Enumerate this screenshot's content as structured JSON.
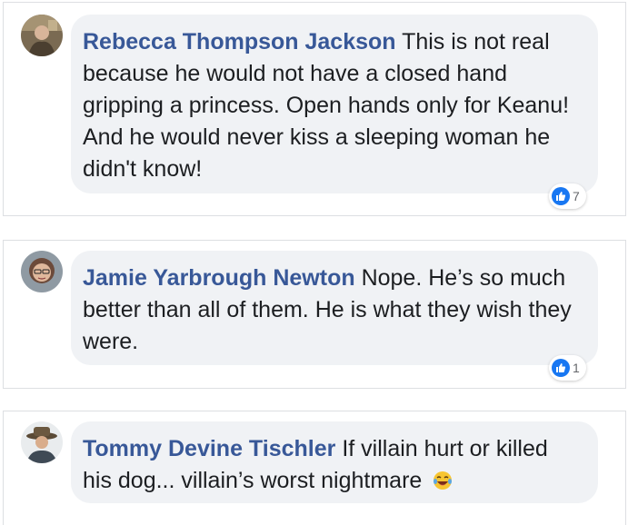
{
  "comments": [
    {
      "author": "Rebecca Thompson Jackson",
      "text": "This is not real because he would not have a closed hand gripping a princess. Open hands only for Keanu! And he would never kiss a sleeping woman he didn't know!",
      "reaction_icon": "like-icon",
      "reaction_count": "7"
    },
    {
      "author": "Jamie Yarbrough Newton",
      "text": "Nope. He’s so much better than all of them. He is what they wish they were.",
      "reaction_icon": "like-icon",
      "reaction_count": "1"
    },
    {
      "author": "Tommy Devine Tischler",
      "text": "If villain hurt or killed his dog... villain’s worst nightmare",
      "emoji": "laughing-tears-emoji"
    }
  ],
  "colors": {
    "author_link": "#385898",
    "bubble_bg": "#f0f2f5",
    "like_blue": "#1877f2",
    "card_border": "#dddfe2"
  }
}
